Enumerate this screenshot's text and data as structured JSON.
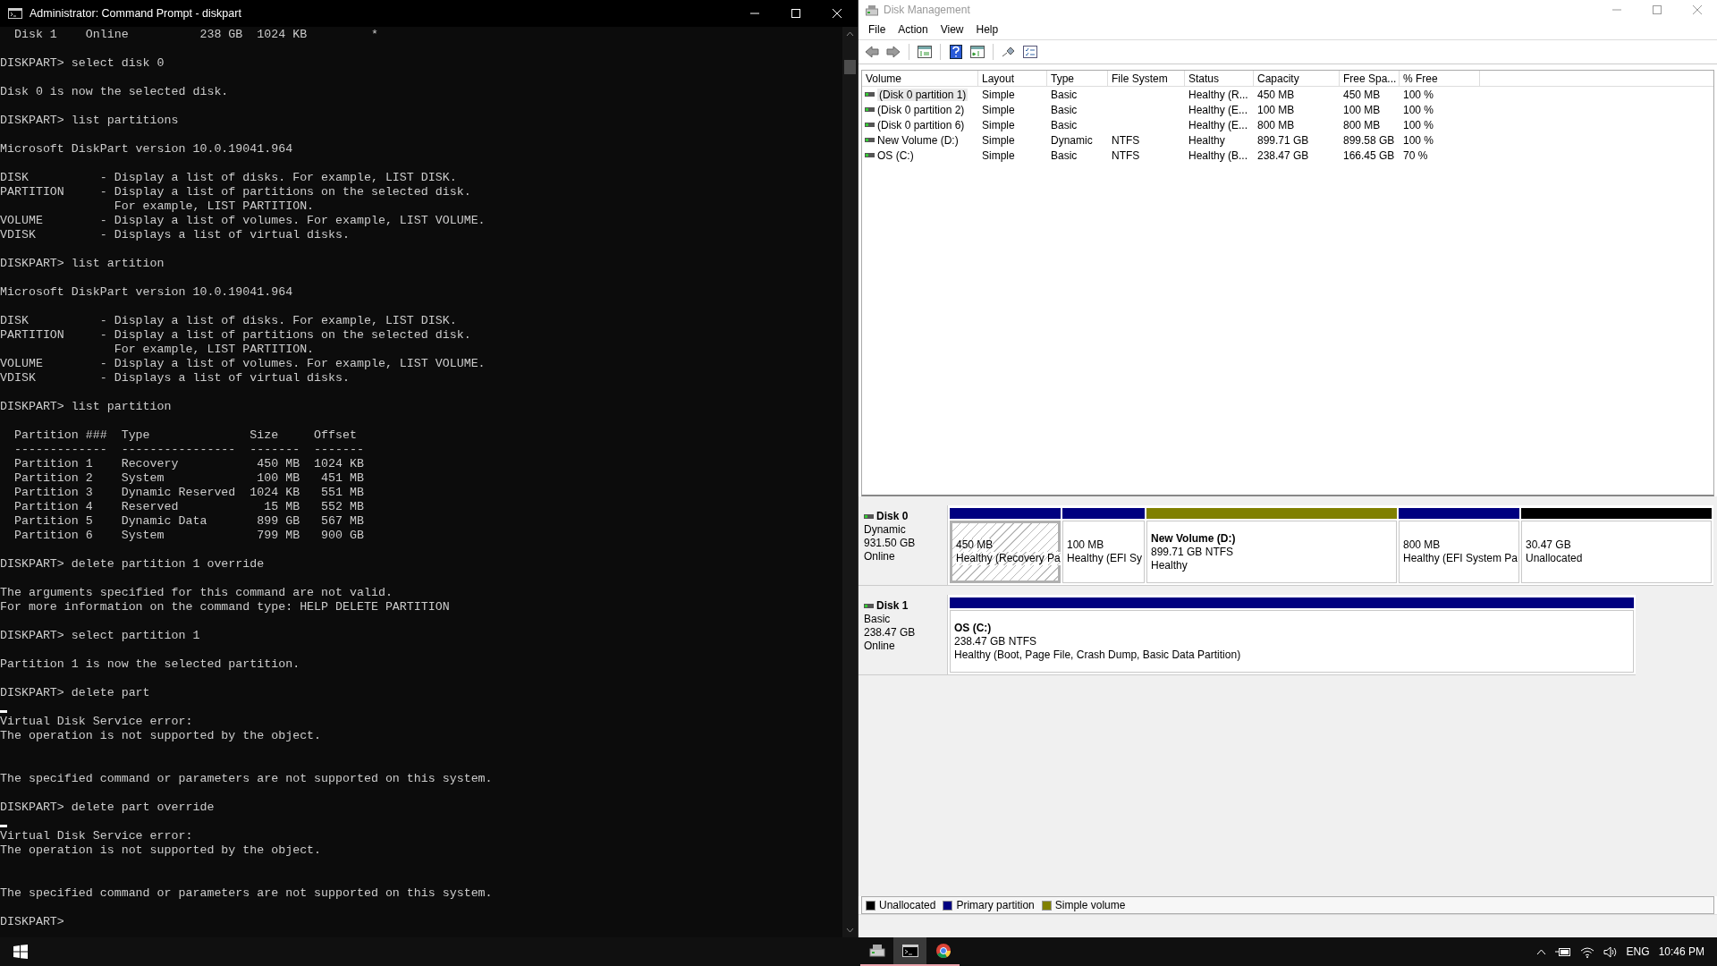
{
  "console_window": {
    "title": "Administrator: Command Prompt - diskpart",
    "lines": [
      {
        "kind": "text",
        "text": "  Disk 1    Online          238 GB  1024 KB         *"
      },
      {
        "kind": "blank"
      },
      {
        "kind": "text",
        "text": "DISKPART> select disk 0"
      },
      {
        "kind": "blank"
      },
      {
        "kind": "text",
        "text": "Disk 0 is now the selected disk."
      },
      {
        "kind": "blank"
      },
      {
        "kind": "text",
        "text": "DISKPART> list partitions"
      },
      {
        "kind": "blank"
      },
      {
        "kind": "text",
        "text": "Microsoft DiskPart version 10.0.19041.964"
      },
      {
        "kind": "blank"
      },
      {
        "kind": "text",
        "text": "DISK          - Display a list of disks. For example, LIST DISK."
      },
      {
        "kind": "text",
        "text": "PARTITION     - Display a list of partitions on the selected disk."
      },
      {
        "kind": "text",
        "text": "                For example, LIST PARTITION."
      },
      {
        "kind": "text",
        "text": "VOLUME        - Display a list of volumes. For example, LIST VOLUME."
      },
      {
        "kind": "text",
        "text": "VDISK         - Displays a list of virtual disks."
      },
      {
        "kind": "blank"
      },
      {
        "kind": "text",
        "text": "DISKPART> list artition"
      },
      {
        "kind": "blank"
      },
      {
        "kind": "text",
        "text": "Microsoft DiskPart version 10.0.19041.964"
      },
      {
        "kind": "blank"
      },
      {
        "kind": "text",
        "text": "DISK          - Display a list of disks. For example, LIST DISK."
      },
      {
        "kind": "text",
        "text": "PARTITION     - Display a list of partitions on the selected disk."
      },
      {
        "kind": "text",
        "text": "                For example, LIST PARTITION."
      },
      {
        "kind": "text",
        "text": "VOLUME        - Display a list of volumes. For example, LIST VOLUME."
      },
      {
        "kind": "text",
        "text": "VDISK         - Displays a list of virtual disks."
      },
      {
        "kind": "blank"
      },
      {
        "kind": "text",
        "text": "DISKPART> list partition"
      },
      {
        "kind": "blank"
      },
      {
        "kind": "text",
        "text": "  Partition ###  Type              Size     Offset"
      },
      {
        "kind": "text",
        "text": "  -------------  ----------------  -------  -------"
      },
      {
        "kind": "text",
        "text": "  Partition 1    Recovery           450 MB  1024 KB"
      },
      {
        "kind": "text",
        "text": "  Partition 2    System             100 MB   451 MB"
      },
      {
        "kind": "text",
        "text": "  Partition 3    Dynamic Reserved  1024 KB   551 MB"
      },
      {
        "kind": "text",
        "text": "  Partition 4    Reserved            15 MB   552 MB"
      },
      {
        "kind": "text",
        "text": "  Partition 5    Dynamic Data       899 GB   567 MB"
      },
      {
        "kind": "text",
        "text": "  Partition 6    System             799 MB   900 GB"
      },
      {
        "kind": "blank"
      },
      {
        "kind": "text",
        "text": "DISKPART> delete partition 1 override"
      },
      {
        "kind": "blank"
      },
      {
        "kind": "text",
        "text": "The arguments specified for this command are not valid."
      },
      {
        "kind": "text",
        "text": "For more information on the command type: HELP DELETE PARTITION"
      },
      {
        "kind": "blank"
      },
      {
        "kind": "text",
        "text": "DISKPART> select partition 1"
      },
      {
        "kind": "blank"
      },
      {
        "kind": "text",
        "text": "Partition 1 is now the selected partition."
      },
      {
        "kind": "blank"
      },
      {
        "kind": "text",
        "text": "DISKPART> delete part"
      },
      {
        "kind": "cursor"
      },
      {
        "kind": "text",
        "text": "Virtual Disk Service error:"
      },
      {
        "kind": "text",
        "text": "The operation is not supported by the object."
      },
      {
        "kind": "blank"
      },
      {
        "kind": "blank"
      },
      {
        "kind": "text",
        "text": "The specified command or parameters are not supported on this system."
      },
      {
        "kind": "blank"
      },
      {
        "kind": "text",
        "text": "DISKPART> delete part override"
      },
      {
        "kind": "cursor"
      },
      {
        "kind": "text",
        "text": "Virtual Disk Service error:"
      },
      {
        "kind": "text",
        "text": "The operation is not supported by the object."
      },
      {
        "kind": "blank"
      },
      {
        "kind": "blank"
      },
      {
        "kind": "text",
        "text": "The specified command or parameters are not supported on this system."
      },
      {
        "kind": "blank"
      },
      {
        "kind": "text",
        "text": "DISKPART>"
      }
    ]
  },
  "disk_management": {
    "title": "Disk Management",
    "menu": [
      "File",
      "Action",
      "View",
      "Help"
    ],
    "toolbar": [
      {
        "kind": "back"
      },
      {
        "kind": "forward"
      },
      {
        "kind": "separator"
      },
      {
        "kind": "console-tree"
      },
      {
        "kind": "separator"
      },
      {
        "kind": "help"
      },
      {
        "kind": "action-pane"
      },
      {
        "kind": "separator"
      },
      {
        "kind": "connect"
      },
      {
        "kind": "checklist"
      }
    ],
    "table": {
      "columns": [
        "Volume",
        "Layout",
        "Type",
        "File System",
        "Status",
        "Capacity",
        "Free Spa...",
        "% Free"
      ],
      "rows": [
        {
          "selected": true,
          "cells": [
            "(Disk 0 partition 1)",
            "Simple",
            "Basic",
            "",
            "Healthy (R...",
            "450 MB",
            "450 MB",
            "100 %"
          ]
        },
        {
          "selected": false,
          "cells": [
            "(Disk 0 partition 2)",
            "Simple",
            "Basic",
            "",
            "Healthy (E...",
            "100 MB",
            "100 MB",
            "100 %"
          ]
        },
        {
          "selected": false,
          "cells": [
            "(Disk 0 partition 6)",
            "Simple",
            "Basic",
            "",
            "Healthy (E...",
            "800 MB",
            "800 MB",
            "100 %"
          ]
        },
        {
          "selected": false,
          "cells": [
            "New Volume (D:)",
            "Simple",
            "Dynamic",
            "NTFS",
            "Healthy",
            "899.71 GB",
            "899.58 GB",
            "100 %"
          ]
        },
        {
          "selected": false,
          "cells": [
            "OS (C:)",
            "Simple",
            "Basic",
            "NTFS",
            "Healthy (B...",
            "238.47 GB",
            "166.45 GB",
            "70 %"
          ]
        }
      ]
    },
    "disks": [
      {
        "name": "Disk 0",
        "type": "Dynamic",
        "size": "931.50 GB",
        "status": "Online",
        "partitions": [
          {
            "kind": "primary",
            "selected": true,
            "lines": [
              "450 MB",
              "Healthy (Recovery Pa"
            ]
          },
          {
            "kind": "primary",
            "selected": false,
            "lines": [
              "100 MB",
              "Healthy (EFI Sy"
            ]
          },
          {
            "kind": "simple",
            "selected": false,
            "name": "New Volume  (D:)",
            "lines": [
              "899.71 GB NTFS",
              "Healthy"
            ]
          },
          {
            "kind": "primary",
            "selected": false,
            "lines": [
              "800 MB",
              "Healthy (EFI System Pa"
            ]
          },
          {
            "kind": "unallocated",
            "selected": false,
            "lines": [
              "30.47 GB",
              "Unallocated"
            ]
          }
        ]
      },
      {
        "name": "Disk 1",
        "type": "Basic",
        "size": "238.47 GB",
        "status": "Online",
        "partitions": [
          {
            "kind": "primary",
            "selected": false,
            "name": "OS  (C:)",
            "lines": [
              "238.47 GB NTFS",
              "Healthy (Boot, Page File, Crash Dump, Basic Data Partition)"
            ]
          }
        ]
      }
    ],
    "legend": [
      {
        "label": "Unallocated",
        "color": "#000000"
      },
      {
        "label": "Primary partition",
        "color": "#000080"
      },
      {
        "label": "Simple volume",
        "color": "#808000"
      }
    ]
  },
  "taskbar": {
    "apps": [
      {
        "kind": "disk-management",
        "selected": false
      },
      {
        "kind": "command-prompt",
        "selected": true
      },
      {
        "kind": "browser",
        "selected": false
      }
    ],
    "language": "ENG",
    "clock": "10:46 PM"
  }
}
